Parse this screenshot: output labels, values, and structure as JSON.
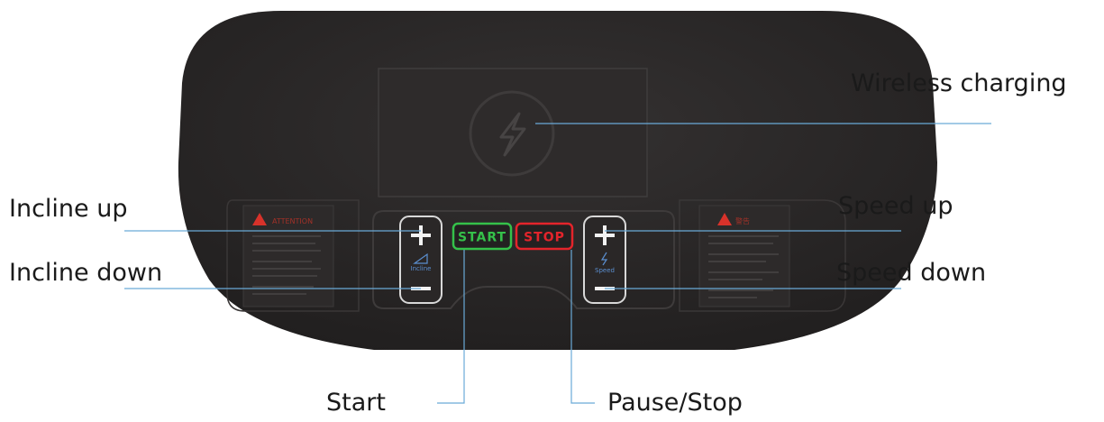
{
  "console": {
    "start_button_label": "START",
    "stop_button_label": "STOP",
    "incline_label": "Incline",
    "speed_label": "Speed",
    "attention_label": "ATTENTION",
    "warning_label_cjk": "警告",
    "plus_symbol": "+",
    "minus_symbol": "−"
  },
  "callouts": {
    "wireless_charging": "Wireless charging",
    "incline_up": "Incline up",
    "incline_down": "Incline down",
    "speed_up": "Speed up",
    "speed_down": "Speed down",
    "start": "Start",
    "pause_stop": "Pause/Stop"
  },
  "colors": {
    "console_body": "#2b2828",
    "leader_line": "#6aaad8",
    "start_green": "#35c14a",
    "stop_red": "#e3242b",
    "warning_red": "#d8322a"
  }
}
